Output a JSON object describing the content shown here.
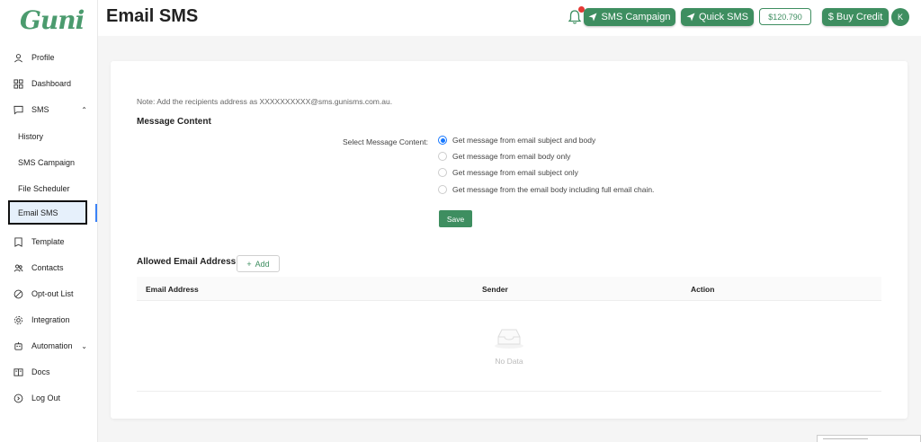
{
  "app": {
    "logo_text": "Guni",
    "page_title": "Email SMS"
  },
  "sidebar": {
    "items": [
      {
        "label": "Profile",
        "icon": "user-icon"
      },
      {
        "label": "Dashboard",
        "icon": "dashboard-grid-icon"
      },
      {
        "label": "SMS",
        "icon": "message-icon",
        "chevron": "^"
      },
      {
        "label": "History",
        "sub": true
      },
      {
        "label": "SMS Campaign",
        "sub": true
      },
      {
        "label": "File Scheduler",
        "sub": true
      },
      {
        "label": "Email SMS",
        "sub": true,
        "active": true
      },
      {
        "label": "Template",
        "icon": "template-icon"
      },
      {
        "label": "Contacts",
        "icon": "contacts-icon"
      },
      {
        "label": "Opt-out List",
        "icon": "ban-icon"
      },
      {
        "label": "Integration",
        "icon": "gear-icon"
      },
      {
        "label": "Automation",
        "icon": "robot-icon",
        "chevron": "v"
      },
      {
        "label": "Docs",
        "icon": "docs-icon"
      },
      {
        "label": "Log Out",
        "icon": "logout-icon"
      }
    ]
  },
  "header": {
    "sms_campaign_label": "SMS Campaign",
    "quick_sms_label": "Quick SMS",
    "credit_balance": "$120.790",
    "buy_credit_label": "$ Buy Credit",
    "avatar_initial": "K"
  },
  "main": {
    "note": "Note: Add the recipients address as XXXXXXXXXX@sms.gunisms.com.au.",
    "message_content_title": "Message Content",
    "select_label": "Select Message Content:",
    "options": [
      {
        "label": "Get message from email subject and body",
        "checked": true
      },
      {
        "label": "Get message from email body only",
        "checked": false
      },
      {
        "label": "Get message from email subject only",
        "checked": false
      },
      {
        "label": "Get message from the email body including full email chain.",
        "checked": false
      }
    ],
    "save_label": "Save",
    "allowed_title": "Allowed Email Address",
    "add_label": "Add",
    "table": {
      "columns": [
        "Email Address",
        "Sender",
        "Action"
      ],
      "empty_text": "No Data"
    }
  },
  "colors": {
    "brand_green": "#3e8e60",
    "radio_blue": "#1677ff",
    "notification_red": "#e53935"
  }
}
